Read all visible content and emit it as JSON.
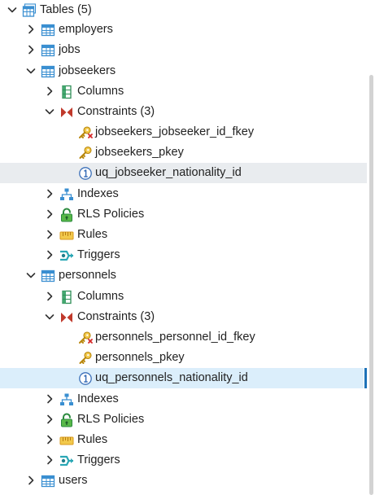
{
  "tree": {
    "tables_label": "Tables (5)",
    "employers": "employers",
    "jobs": "jobs",
    "jobseekers": {
      "label": "jobseekers",
      "columns": "Columns",
      "constraints": "Constraints (3)",
      "fkey": "jobseekers_jobseeker_id_fkey",
      "pkey": "jobseekers_pkey",
      "unique": "uq_jobseeker_nationality_id",
      "indexes": "Indexes",
      "rls": "RLS Policies",
      "rules": "Rules",
      "triggers": "Triggers"
    },
    "personnels": {
      "label": "personnels",
      "columns": "Columns",
      "constraints": "Constraints (3)",
      "fkey": "personnels_personnel_id_fkey",
      "pkey": "personnels_pkey",
      "unique": "uq_personnels_nationality_id",
      "indexes": "Indexes",
      "rls": "RLS Policies",
      "rules": "Rules",
      "triggers": "Triggers"
    },
    "users": "users"
  },
  "colors": {
    "table_icon": "#3a8fd1",
    "hover_row": "#e9ecef",
    "selected_row": "#dbeefb",
    "selection_bar": "#1d72b8",
    "constraint_icon": "#c0392b",
    "key_icon": "#d4a017"
  },
  "icons": {
    "tables": "table-group-icon",
    "table": "table-icon",
    "columns": "columns-icon",
    "constraints": "constraints-icon",
    "foreign_key": "foreign-key-icon",
    "primary_key": "primary-key-icon",
    "unique": "unique-constraint-icon",
    "indexes": "indexes-icon",
    "rls": "rls-policy-icon",
    "rules": "rules-icon",
    "triggers": "triggers-icon"
  }
}
